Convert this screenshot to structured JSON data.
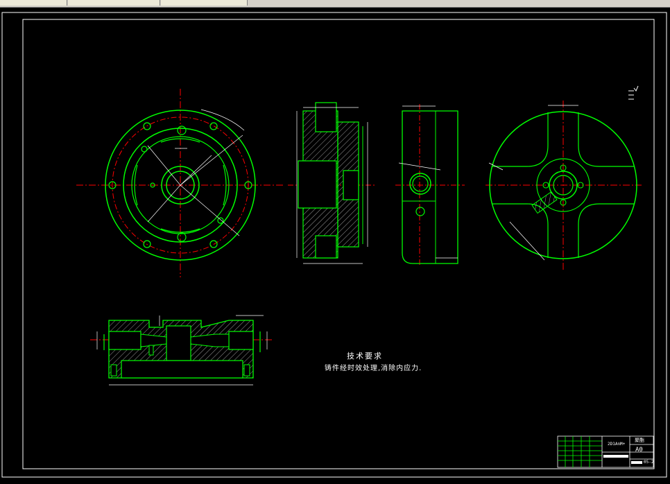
{
  "notes": {
    "title": "技术要求",
    "body": "铸件经时效处理,消除内应力."
  },
  "title_block": {
    "scale_label": "2D1AnM+",
    "material": "聚酯",
    "sheet_size": "A0",
    "drawing_no": "05-2"
  },
  "colors": {
    "part": "#00ff00",
    "centerline": "#ff0000",
    "dimension": "#ffffff",
    "background": "#000000"
  }
}
